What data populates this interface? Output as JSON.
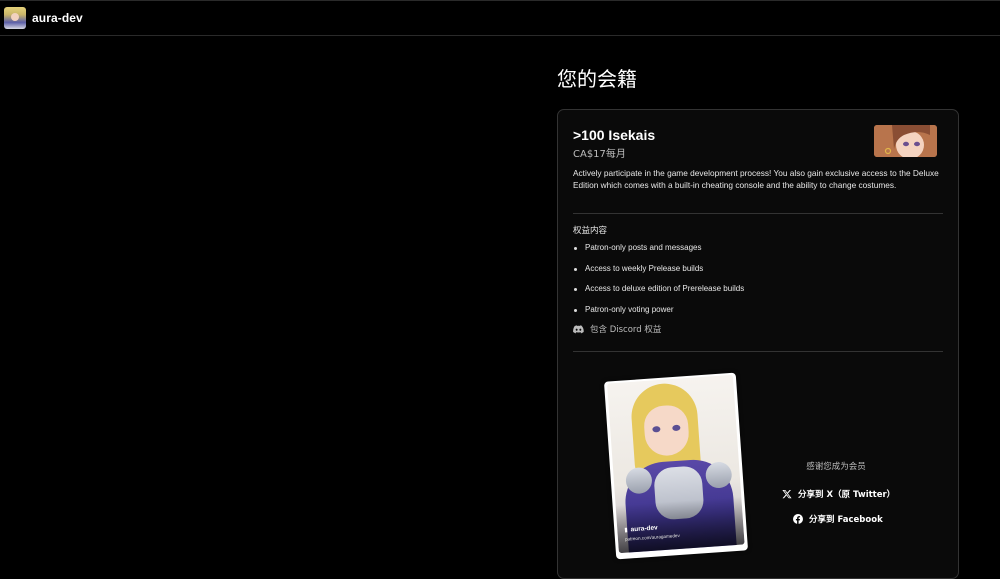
{
  "header": {
    "creator_name": "aura-dev"
  },
  "membership": {
    "title": "您的会籍",
    "tier_name": ">100 Isekais",
    "price": "CA$17每月",
    "description": "Actively participate in the game development process! You also gain exclusive access to the Deluxe Edition which comes with a built-in cheating console and the ability to change costumes.",
    "benefits_heading": "权益内容",
    "benefits": [
      "Patron-only posts and messages",
      "Access to weekly Prelease builds",
      "Access to deluxe edition of Prerelease builds",
      "Patron-only voting power"
    ],
    "discord_benefit": "包含 Discord 权益"
  },
  "share": {
    "card_creator": "aura-dev",
    "card_url": "patreon.com/auragamedev",
    "thanks_text": "感谢您成为会员",
    "share_x_label": "分享到 X（原 Twitter）",
    "share_facebook_label": "分享到 Facebook"
  }
}
